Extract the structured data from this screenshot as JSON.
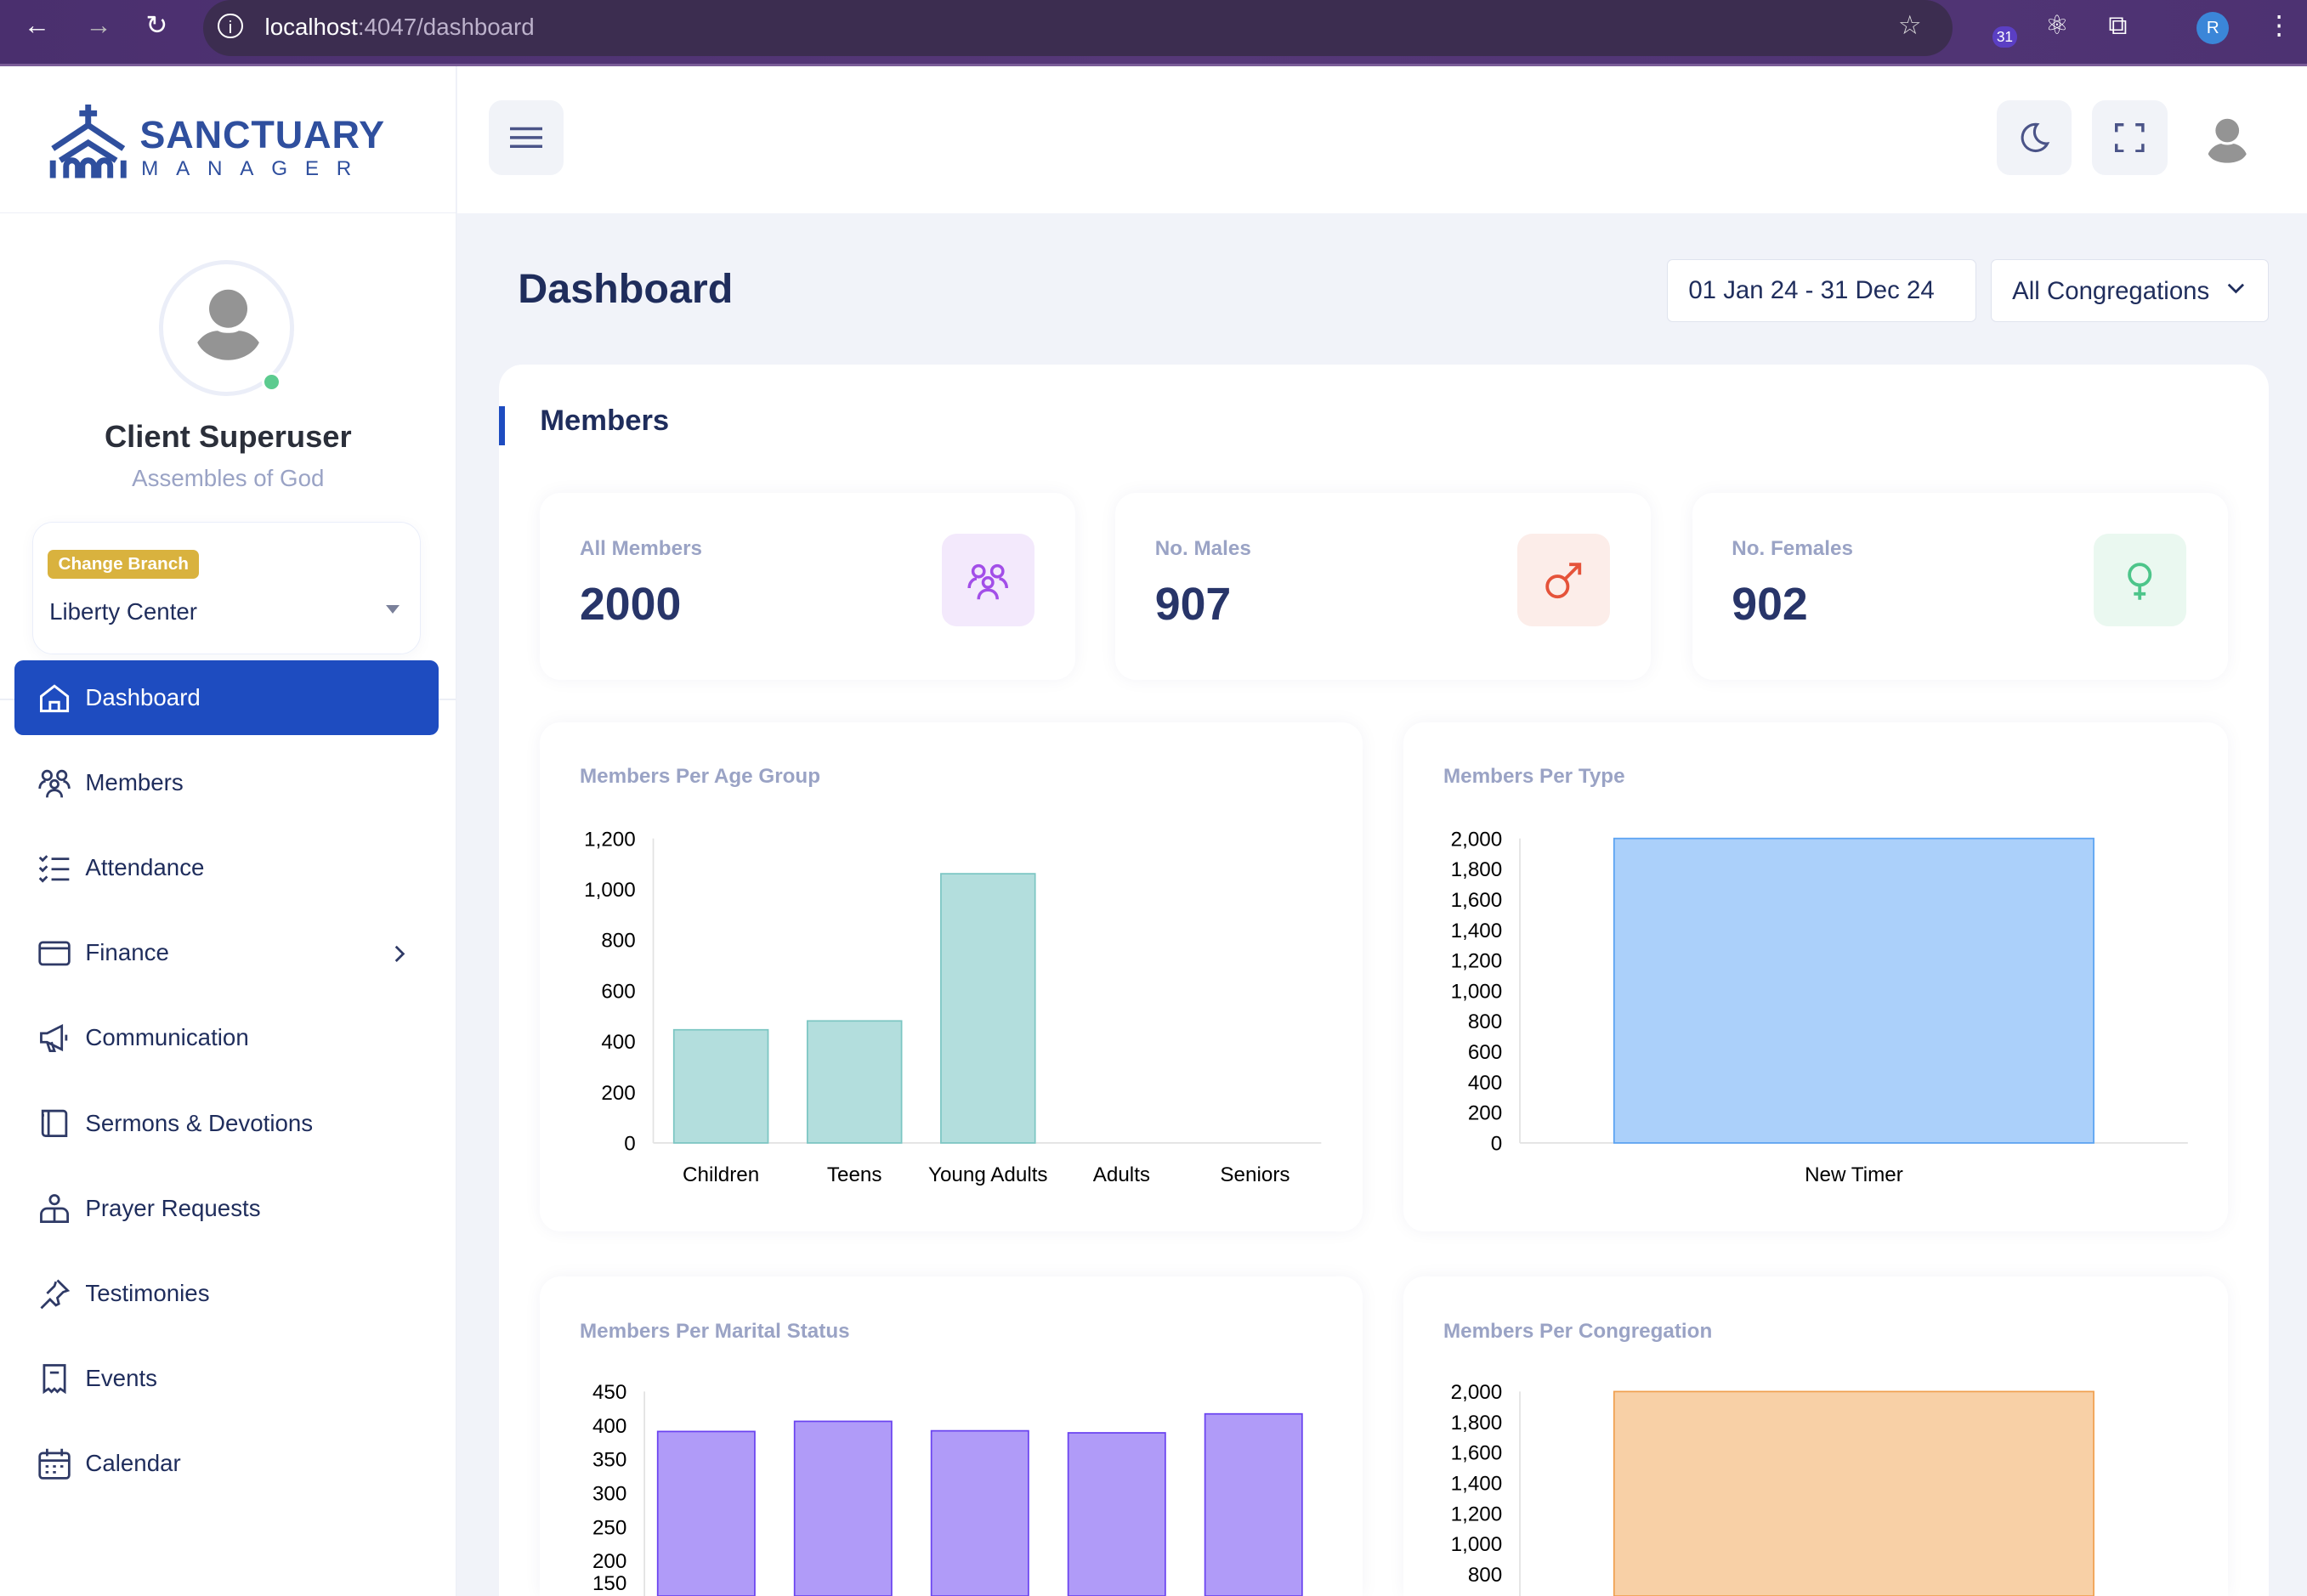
{
  "browser": {
    "url_host": "localhost",
    "url_path": ":4047/dashboard",
    "extension_badge": "31",
    "profile_initial": "R"
  },
  "brand": {
    "name": "SANCTUARY",
    "sub": "MANAGER",
    "color": "#2f4f9e"
  },
  "user": {
    "name": "Client Superuser",
    "org": "Assembles of God",
    "status_color": "#5ccb8f"
  },
  "branch": {
    "badge": "Change Branch",
    "value": "Liberty Center"
  },
  "nav": [
    {
      "label": "Dashboard",
      "icon": "home-icon",
      "active": true
    },
    {
      "label": "Members",
      "icon": "users-icon"
    },
    {
      "label": "Attendance",
      "icon": "checklist-icon"
    },
    {
      "label": "Finance",
      "icon": "wallet-icon",
      "has_children": true
    },
    {
      "label": "Communication",
      "icon": "megaphone-icon"
    },
    {
      "label": "Sermons & Devotions",
      "icon": "book-icon"
    },
    {
      "label": "Prayer Requests",
      "icon": "praying-hands-icon"
    },
    {
      "label": "Testimonies",
      "icon": "pin-icon"
    },
    {
      "label": "Events",
      "icon": "ticket-icon"
    },
    {
      "label": "Calendar",
      "icon": "calendar-icon"
    }
  ],
  "page": {
    "title": "Dashboard",
    "date_range": "01 Jan 24 - 31 Dec 24",
    "congregation": "All Congregations"
  },
  "members": {
    "section_title": "Members",
    "stats": [
      {
        "label": "All Members",
        "value": "2000",
        "icon": "users-icon",
        "color": "#a24ee8",
        "bg": "#f3e9fc"
      },
      {
        "label": "No. Males",
        "value": "907",
        "icon": "male-icon",
        "color": "#e5533a",
        "bg": "#fcede9"
      },
      {
        "label": "No. Females",
        "value": "902",
        "icon": "female-icon",
        "color": "#4dc58a",
        "bg": "#eaf8f0"
      }
    ]
  },
  "chart_data": [
    {
      "type": "bar",
      "title": "Members Per Age Group",
      "categories": [
        "Children",
        "Teens",
        "Young Adults",
        "Adults",
        "Seniors"
      ],
      "values": [
        446,
        481,
        1061,
        0,
        0
      ],
      "ylim": [
        0,
        1200
      ],
      "yticks": [
        0,
        200,
        400,
        600,
        800,
        1000,
        1200
      ],
      "color": "#b3dedd",
      "border": "#7cc6c3"
    },
    {
      "type": "bar",
      "title": "Members Per Type",
      "categories": [
        "New Timer"
      ],
      "values": [
        2000
      ],
      "ylim": [
        0,
        2000
      ],
      "yticks": [
        0,
        200,
        400,
        600,
        800,
        1000,
        1200,
        1400,
        1600,
        1800,
        2000
      ],
      "color": "#abd0fa",
      "border": "#5aa2f2"
    },
    {
      "type": "bar",
      "title": "Members Per Marital Status",
      "values": [
        391,
        406,
        392,
        389,
        417
      ],
      "ylim": [
        0,
        450
      ],
      "yticks": [
        150,
        200,
        250,
        300,
        350,
        400,
        450
      ],
      "color": "#b09bf8",
      "border": "#6a43f0"
    },
    {
      "type": "bar",
      "title": "Members Per Congregation",
      "values": [
        2000
      ],
      "ylim": [
        0,
        2000
      ],
      "yticks": [
        800,
        1000,
        1200,
        1400,
        1600,
        1800,
        2000
      ],
      "color": "#f8d0a6",
      "border": "#f0a050"
    }
  ]
}
